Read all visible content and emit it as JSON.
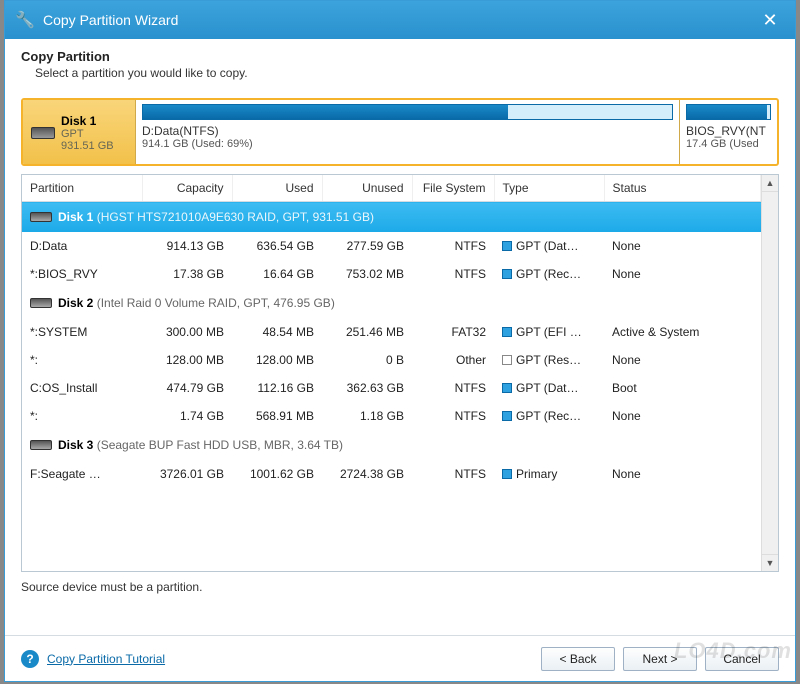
{
  "window": {
    "title": "Copy Partition Wizard"
  },
  "header": {
    "title": "Copy Partition",
    "subtitle": "Select a partition you would like to copy."
  },
  "selected_disk": {
    "name": "Disk 1",
    "type": "GPT",
    "size": "931.51 GB",
    "main_partition": {
      "label": "D:Data(NTFS)",
      "sub": "914.1 GB (Used: 69%)",
      "used_pct": 69
    },
    "side_partition": {
      "label": "BIOS_RVY(NT",
      "sub": "17.4 GB (Used"
    }
  },
  "columns": [
    "Partition",
    "Capacity",
    "Used",
    "Unused",
    "File System",
    "Type",
    "Status"
  ],
  "rows": [
    {
      "kind": "disk",
      "selected": true,
      "name": "Disk 1",
      "detail": "(HGST HTS721010A9E630 RAID, GPT, 931.51 GB)"
    },
    {
      "kind": "part",
      "name": "D:Data",
      "capacity": "914.13 GB",
      "used": "636.54 GB",
      "unused": "277.59 GB",
      "fs": "NTFS",
      "type": "GPT (Dat…",
      "status": "None"
    },
    {
      "kind": "part",
      "name": "*:BIOS_RVY",
      "capacity": "17.38 GB",
      "used": "16.64 GB",
      "unused": "753.02 MB",
      "fs": "NTFS",
      "type": "GPT (Rec…",
      "status": "None"
    },
    {
      "kind": "disk",
      "selected": false,
      "name": "Disk 2",
      "detail": "(Intel Raid 0 Volume RAID, GPT, 476.95 GB)"
    },
    {
      "kind": "part",
      "name": "*:SYSTEM",
      "capacity": "300.00 MB",
      "used": "48.54 MB",
      "unused": "251.46 MB",
      "fs": "FAT32",
      "type": "GPT (EFI …",
      "status": "Active & System"
    },
    {
      "kind": "part",
      "name": "*:",
      "capacity": "128.00 MB",
      "used": "128.00 MB",
      "unused": "0 B",
      "fs": "Other",
      "type": "GPT (Res…",
      "status": "None",
      "other": true
    },
    {
      "kind": "part",
      "name": "C:OS_Install",
      "capacity": "474.79 GB",
      "used": "112.16 GB",
      "unused": "362.63 GB",
      "fs": "NTFS",
      "type": "GPT (Dat…",
      "status": "Boot"
    },
    {
      "kind": "part",
      "name": "*:",
      "capacity": "1.74 GB",
      "used": "568.91 MB",
      "unused": "1.18 GB",
      "fs": "NTFS",
      "type": "GPT (Rec…",
      "status": "None"
    },
    {
      "kind": "disk",
      "selected": false,
      "name": "Disk 3",
      "detail": "(Seagate BUP Fast HDD USB, MBR, 3.64 TB)"
    },
    {
      "kind": "part",
      "name": "F:Seagate …",
      "capacity": "3726.01 GB",
      "used": "1001.62 GB",
      "unused": "2724.38 GB",
      "fs": "NTFS",
      "type": "Primary",
      "status": "None"
    }
  ],
  "footer_msg": "Source device must be a partition.",
  "tutorial": "Copy Partition Tutorial",
  "buttons": {
    "back": "< Back",
    "next": "Next >",
    "cancel": "Cancel"
  },
  "watermark": "LO4D.com"
}
